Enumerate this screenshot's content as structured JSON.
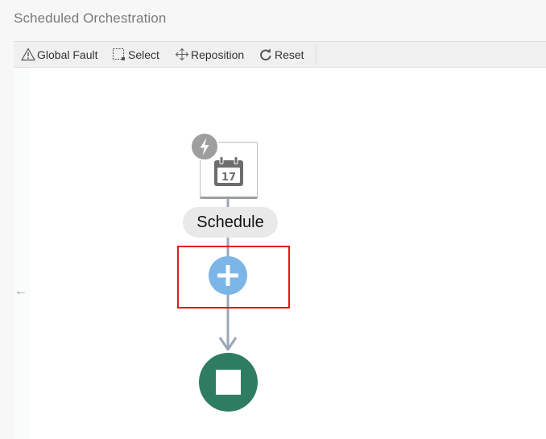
{
  "window": {
    "title": "Scheduled Orchestration"
  },
  "toolbar": {
    "global_fault": {
      "label": "Global Fault",
      "icon": "warning-triangle-icon"
    },
    "select": {
      "label": "Select",
      "icon": "marquee-select-icon"
    },
    "reposition": {
      "label": "Reposition",
      "icon": "move-arrows-icon"
    },
    "reset": {
      "label": "Reset",
      "icon": "reset-arrow-icon"
    }
  },
  "canvas": {
    "collapse_glyph": "←",
    "trigger": {
      "badge_icon": "lightning-bolt-icon",
      "icon": "calendar-icon",
      "calendar_day": "17",
      "label": "Schedule"
    },
    "add_action": {
      "icon": "plus-icon"
    },
    "end_node": {
      "icon": "stop-square-icon"
    }
  },
  "colors": {
    "accent_add": "#7cb6e6",
    "end_node": "#2e7d63",
    "connector": "#9aa7b6",
    "highlight": "#e3161d"
  }
}
